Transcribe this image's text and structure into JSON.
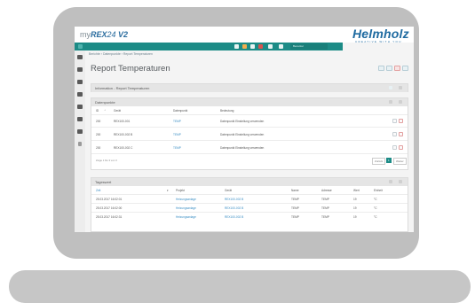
{
  "app": {
    "brand_prefix": "my",
    "brand_name": "REX",
    "brand_num": "24",
    "brand_version": "V2",
    "logo": "Helmholz",
    "tagline": "CREATIVE WITH YOU"
  },
  "toolbar": {
    "user_label": "Benutzer"
  },
  "breadcrumb": "Berichte › Datenpunkte › Report Temperaturen",
  "page": {
    "title": "Report Temperaturen"
  },
  "info_panel": {
    "title": "Information - Report Temperaturen"
  },
  "datapoints": {
    "title": "Datenpunkte",
    "columns": [
      "ID",
      "Gerät",
      "Datenpunkt",
      "Bedeutung"
    ],
    "rows": [
      {
        "id": "200",
        "device": "REX100-001",
        "datapoint": "TEMP",
        "meaning": "Datenpunkt Einstellung verwenden"
      },
      {
        "id": "200",
        "device": "REX100-002 B",
        "datapoint": "TEMP",
        "meaning": "Datenpunkt Einstellung verwenden"
      },
      {
        "id": "200",
        "device": "REX100-002 C",
        "datapoint": "TEMP",
        "meaning": "Datenpunkt Einstellung verwenden"
      }
    ],
    "footer": "Zeige 1 bis 3 von 3",
    "prev": "Zurück",
    "page": "1",
    "next": "Weiter"
  },
  "daily": {
    "title": "Tageswert",
    "columns": [
      "Zeit",
      "Projekt",
      "Gerät",
      "Name",
      "Adresse",
      "Wert",
      "Einheit"
    ],
    "rows": [
      {
        "time": "25.03.2017 16:02:01",
        "project": "Heizungsanlage",
        "device": "REX100-002 B",
        "name": "TEMP",
        "address": "TEMP",
        "value": "19",
        "unit": "°C"
      },
      {
        "time": "25.03.2017 16:02:00",
        "project": "Heizungsanlage",
        "device": "REX100-002 B",
        "name": "TEMP",
        "address": "TEMP",
        "value": "19",
        "unit": "°C"
      },
      {
        "time": "25.03.2017 16:02:31",
        "project": "Heizungsanlage",
        "device": "REX100-002 B",
        "name": "TEMP",
        "address": "TEMP",
        "value": "19",
        "unit": "°C"
      }
    ]
  },
  "colors": {
    "teal": "#1c8b86",
    "brand_blue": "#1e6aa0",
    "link": "#3a8ec4",
    "danger": "#d9534f",
    "frame": "#bfbfbf"
  }
}
